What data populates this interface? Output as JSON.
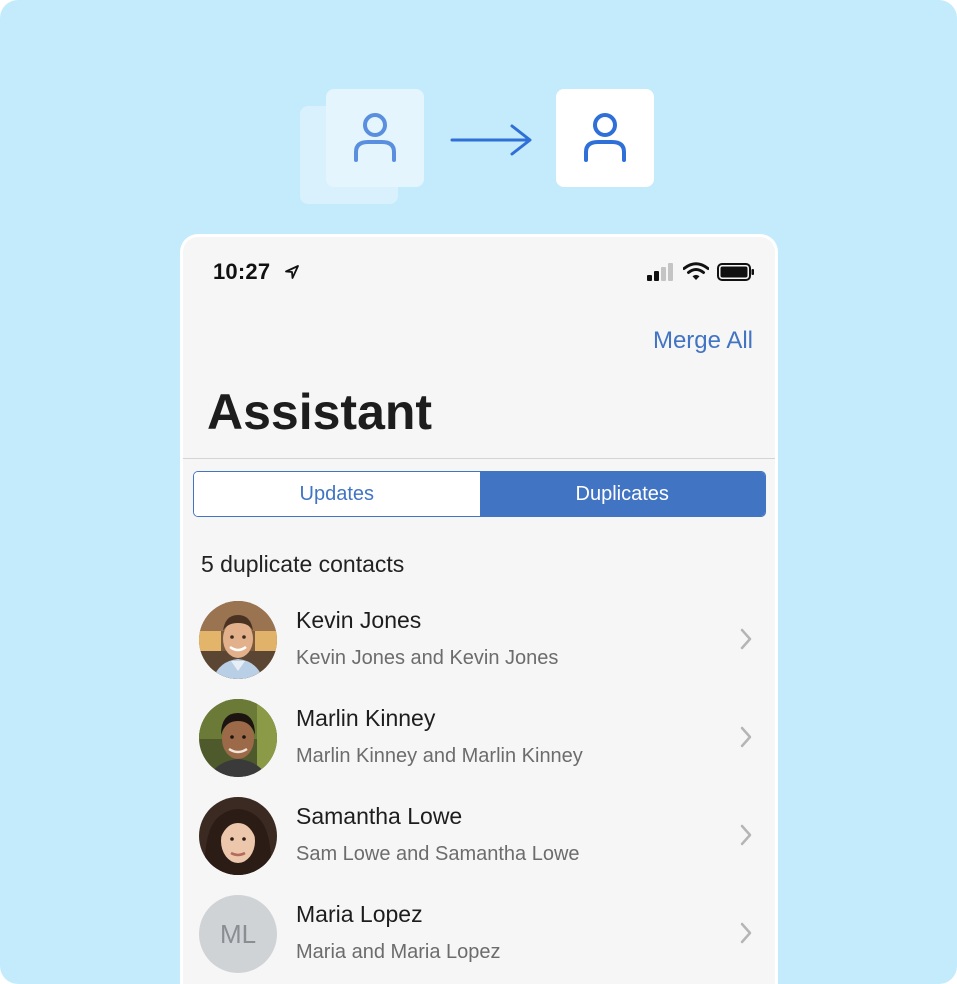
{
  "status_bar": {
    "time": "10:27"
  },
  "header": {
    "merge_all_label": "Merge All",
    "title": "Assistant"
  },
  "tabs": [
    {
      "label": "Updates",
      "selected": false
    },
    {
      "label": "Duplicates",
      "selected": true
    }
  ],
  "section_header": "5 duplicate contacts",
  "contacts": [
    {
      "name": "Kevin Jones",
      "detail": "Kevin Jones and Kevin Jones",
      "avatar": "photo"
    },
    {
      "name": "Marlin Kinney",
      "detail": "Marlin Kinney and Marlin Kinney",
      "avatar": "photo"
    },
    {
      "name": "Samantha Lowe",
      "detail": "Sam Lowe and Samantha Lowe",
      "avatar": "photo"
    },
    {
      "name": "Maria Lopez",
      "detail": "Maria and Maria Lopez",
      "avatar": "initials",
      "initials": "ML"
    }
  ],
  "colors": {
    "background": "#c3ebfc",
    "accent": "#4274c4",
    "phone_bg": "#f6f6f6"
  },
  "icons": {
    "illustration_source": "person-icon",
    "illustration_arrow": "arrow-right-icon",
    "illustration_target": "person-icon",
    "location": "location-arrow-icon",
    "signal": "cellular-signal-icon",
    "wifi": "wifi-icon",
    "battery": "battery-icon",
    "row_chevron": "chevron-right-icon"
  }
}
